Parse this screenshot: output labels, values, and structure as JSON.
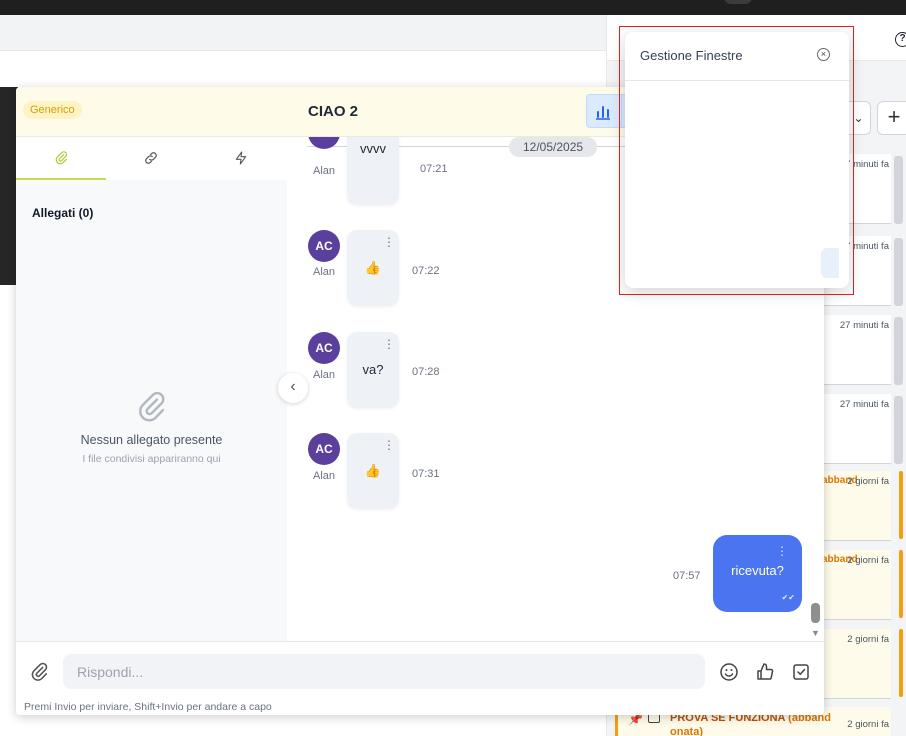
{
  "window": {
    "badge": "Generico",
    "title": "CIAO 2"
  },
  "window_manager": {
    "title": "Gestione Finestre"
  },
  "sidebar": {
    "attachments_title": "Allegati (0)",
    "empty_title": "Nessun allegato presente",
    "empty_subtitle": "I file condivisi appariranno qui"
  },
  "messages": {
    "date": "12/05/2025",
    "items": [
      {
        "initials": "AC",
        "sender": "Alan",
        "text": "vvvv",
        "time": "07:21"
      },
      {
        "initials": "AC",
        "sender": "Alan",
        "text": "👍",
        "time": "07:22"
      },
      {
        "initials": "AC",
        "sender": "Alan",
        "text": "va?",
        "time": "07:28"
      },
      {
        "initials": "AC",
        "sender": "Alan",
        "text": "👍",
        "time": "07:31"
      }
    ],
    "own": {
      "text": "ricevuta?",
      "time": "07:57"
    }
  },
  "composer": {
    "placeholder": "Rispondi...",
    "hint": "Premi Invio per inviare, Shift+Invio per andare a capo"
  },
  "background_list": {
    "items": [
      {
        "time": "27 minuti fa"
      },
      {
        "time": "27 minuti fa"
      },
      {
        "time": "27 minuti fa"
      },
      {
        "time": "27 minuti fa"
      },
      {
        "tag": "abband",
        "time": "2 giorni fa"
      },
      {
        "tag": "abband",
        "time": "2 giorni fa"
      },
      {
        "tag": "",
        "time": "2 giorni fa"
      }
    ],
    "last": {
      "title": "PROVA SE FUNZIONA",
      "tag": "(abband onata)",
      "time": "2 giorni fa"
    }
  },
  "colors": {
    "accent": "#4a74f0",
    "avatar": "#5b3f9c",
    "header_bg": "#fefce8",
    "badge_text": "#d4a106",
    "tab_active": "#c8dc48",
    "warning": "#f59e0b",
    "highlight_frame": "#e11d1d"
  }
}
